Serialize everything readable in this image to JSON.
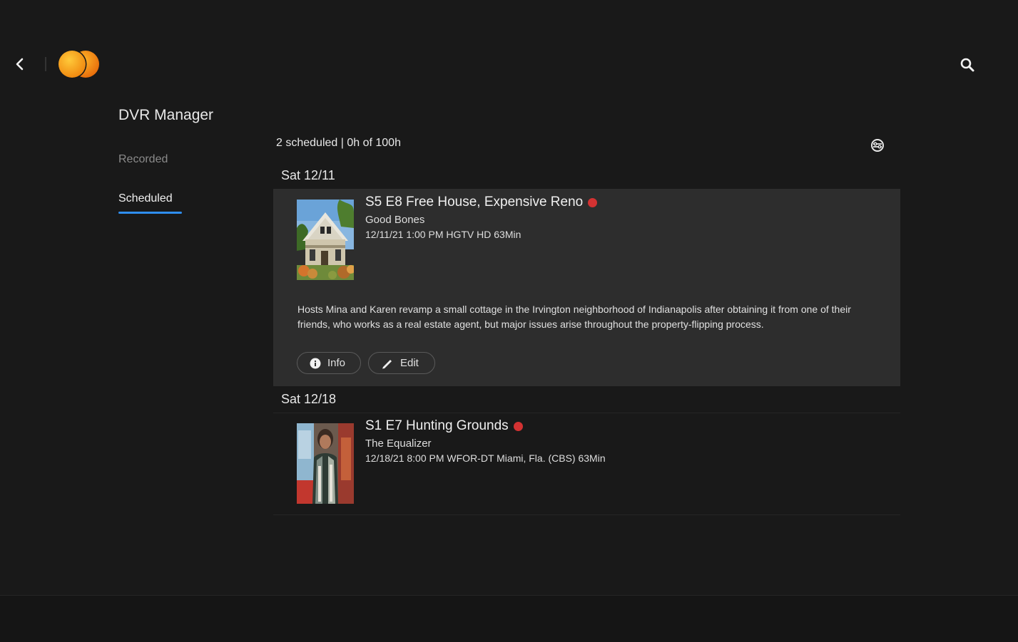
{
  "header": {
    "back_icon": "chevron-left-icon",
    "logo_icon": "orange-circles-logo",
    "search_icon": "search-icon",
    "logo_colors": [
      "#f4a21a",
      "#f07a10"
    ]
  },
  "sidebar": {
    "title": "DVR Manager",
    "items": [
      {
        "label": "Recorded",
        "active": false
      },
      {
        "label": "Scheduled",
        "active": true
      }
    ],
    "active_color": "#2f8ef0"
  },
  "main": {
    "summary": "2 scheduled | 0h of 100h",
    "settings_icon": "settings-icon",
    "groups": [
      {
        "day": "Sat 12/11",
        "items": [
          {
            "title": "S5 E8 Free House, Expensive Reno",
            "series": "Good Bones",
            "meta": "12/11/21 1:00 PM  HGTV HD 63Min",
            "description": "Hosts Mina and Karen revamp a small cottage in the Irvington neighborhood of Indianapolis after obtaining it from one of their friends, who works as a real estate agent, but major issues arise throughout the property-flipping process.",
            "info_label": "Info",
            "edit_label": "Edit",
            "recording_color": "#d33232"
          }
        ]
      },
      {
        "day": "Sat 12/18",
        "items": [
          {
            "title": "S1 E7 Hunting Grounds",
            "series": "The Equalizer",
            "meta": "12/18/21 8:00 PM  WFOR-DT Miami, Fla. (CBS) 63Min",
            "recording_color": "#d33232"
          }
        ]
      }
    ]
  }
}
